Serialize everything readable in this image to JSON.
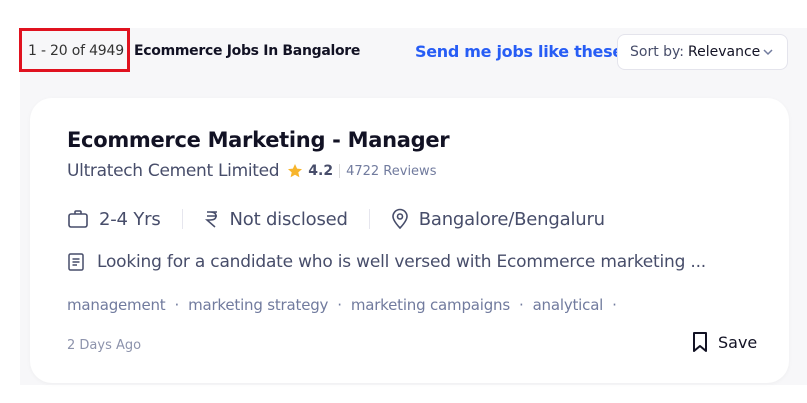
{
  "results": {
    "count_text": "1 - 20 of 4949",
    "title": "Ecommerce Jobs In Bangalore"
  },
  "header": {
    "send_jobs_label": "Send me jobs like these",
    "sort_label": "Sort by:",
    "sort_value": "Relevance"
  },
  "job": {
    "title": "Ecommerce Marketing - Manager",
    "company": "Ultratech Cement Limited",
    "rating": "4.2",
    "reviews": "4722 Reviews",
    "experience": "2-4 Yrs",
    "salary": "Not disclosed",
    "location": "Bangalore/Bengaluru",
    "description": "Looking for a candidate who is well versed with Ecommerce marketing ...",
    "tags": [
      "management",
      "marketing strategy",
      "marketing campaigns",
      "analytical"
    ],
    "posted": "2 Days Ago",
    "save_label": "Save"
  },
  "colors": {
    "highlight": "#e0121f",
    "link": "#275df5",
    "star": "#f7b52c"
  }
}
